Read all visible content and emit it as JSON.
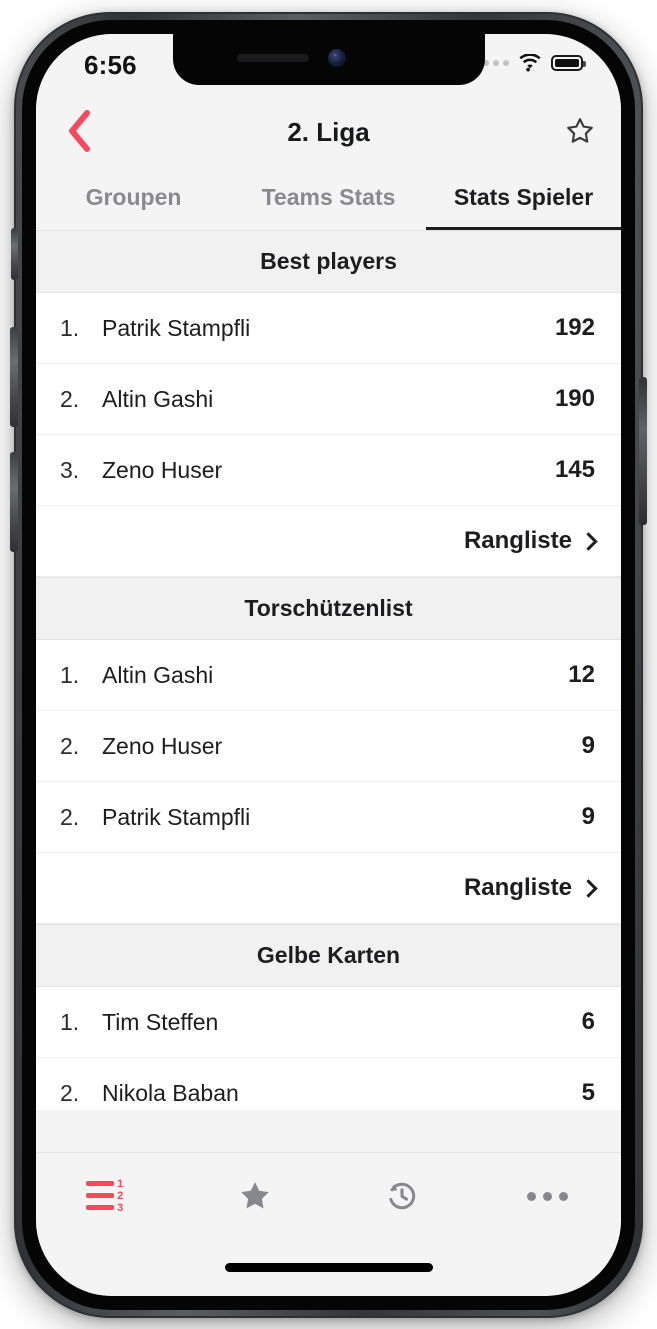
{
  "status_bar": {
    "time": "6:56",
    "signal_icon": "signal-dots-icon",
    "wifi_icon": "wifi-icon",
    "battery_icon": "battery-full-icon"
  },
  "nav": {
    "back_icon": "chevron-left-icon",
    "title": "2. Liga",
    "favorite_icon": "star-outline-icon",
    "accent_color": "#f8485e"
  },
  "tabs": [
    {
      "label": "Groupen",
      "active": false
    },
    {
      "label": "Teams Stats",
      "active": false
    },
    {
      "label": "Stats Spieler",
      "active": true
    }
  ],
  "sections": [
    {
      "title": "Best players",
      "rows": [
        {
          "rank": "1.",
          "name": "Patrik Stampfli",
          "value": "192"
        },
        {
          "rank": "2.",
          "name": "Altin Gashi",
          "value": "190"
        },
        {
          "rank": "3.",
          "name": "Zeno Huser",
          "value": "145"
        }
      ],
      "more_label": "Rangliste",
      "more_icon": "chevron-right-icon"
    },
    {
      "title": "Torschützenlist",
      "rows": [
        {
          "rank": "1.",
          "name": "Altin Gashi",
          "value": "12"
        },
        {
          "rank": "2.",
          "name": "Zeno Huser",
          "value": "9"
        },
        {
          "rank": "2.",
          "name": "Patrik Stampfli",
          "value": "9"
        }
      ],
      "more_label": "Rangliste",
      "more_icon": "chevron-right-icon"
    },
    {
      "title": "Gelbe Karten",
      "rows": [
        {
          "rank": "1.",
          "name": "Tim Steffen",
          "value": "6"
        },
        {
          "rank": "2.",
          "name": "Nikola Baban",
          "value": "5"
        }
      ],
      "more_label": "",
      "more_icon": ""
    }
  ],
  "bottom_tabbar": [
    {
      "icon": "ranking-list-icon",
      "active": true,
      "color": "#f8485e"
    },
    {
      "icon": "star-filled-icon",
      "active": false,
      "color": "#87888b"
    },
    {
      "icon": "history-clock-icon",
      "active": false,
      "color": "#87888b"
    },
    {
      "icon": "more-dots-icon",
      "active": false,
      "color": "#87888b"
    }
  ]
}
